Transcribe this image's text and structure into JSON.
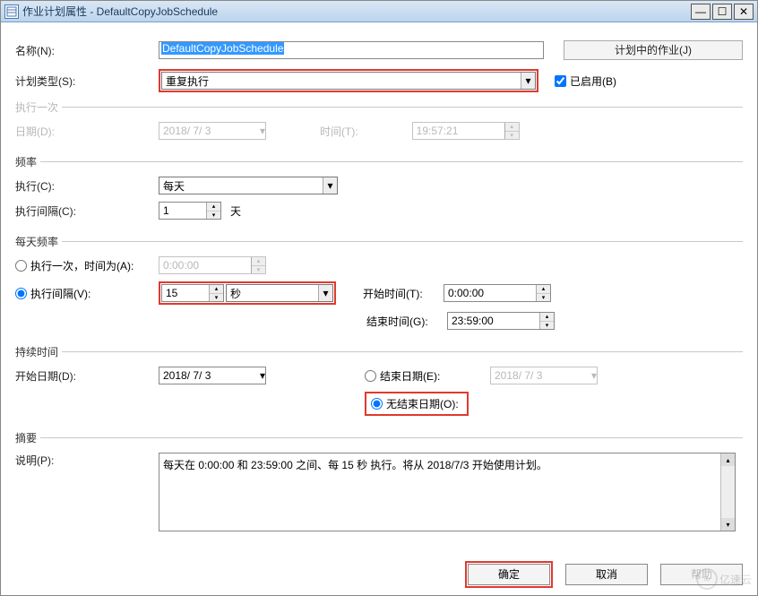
{
  "window": {
    "title": "作业计划属性 - DefaultCopyJobSchedule"
  },
  "name_section": {
    "label": "名称(N):",
    "value": "DefaultCopyJobSchedule",
    "scheduled_jobs_btn": "计划中的作业(J)"
  },
  "type_section": {
    "label": "计划类型(S):",
    "value": "重复执行",
    "enabled_chk": "已启用(B)"
  },
  "once_section": {
    "legend": "执行一次",
    "date_label": "日期(D):",
    "date_value": "2018/ 7/ 3",
    "time_label": "时间(T):",
    "time_value": "19:57:21"
  },
  "freq_section": {
    "legend": "频率",
    "exec_label": "执行(C):",
    "exec_value": "每天",
    "interval_label": "执行间隔(C):",
    "interval_value": "1",
    "interval_unit": "天"
  },
  "daily_section": {
    "legend": "每天频率",
    "once_radio": "执行一次，时间为(A):",
    "once_time": "0:00:00",
    "interval_radio": "执行间隔(V):",
    "interval_value": "15",
    "interval_unit": "秒",
    "start_label": "开始时间(T):",
    "start_value": "0:00:00",
    "end_label": "结束时间(G):",
    "end_value": "23:59:00"
  },
  "duration_section": {
    "legend": "持续时间",
    "start_date_label": "开始日期(D):",
    "start_date_value": "2018/ 7/ 3",
    "end_date_radio": "结束日期(E):",
    "end_date_value": "2018/ 7/ 3",
    "no_end_radio": "无结束日期(O):"
  },
  "summary_section": {
    "legend": "摘要",
    "desc_label": "说明(P):",
    "desc_value": "每天在 0:00:00 和 23:59:00 之间、每 15 秒 执行。将从 2018/7/3 开始使用计划。"
  },
  "buttons": {
    "ok": "确定",
    "cancel": "取消",
    "help": "帮助"
  },
  "watermark": "亿速云"
}
